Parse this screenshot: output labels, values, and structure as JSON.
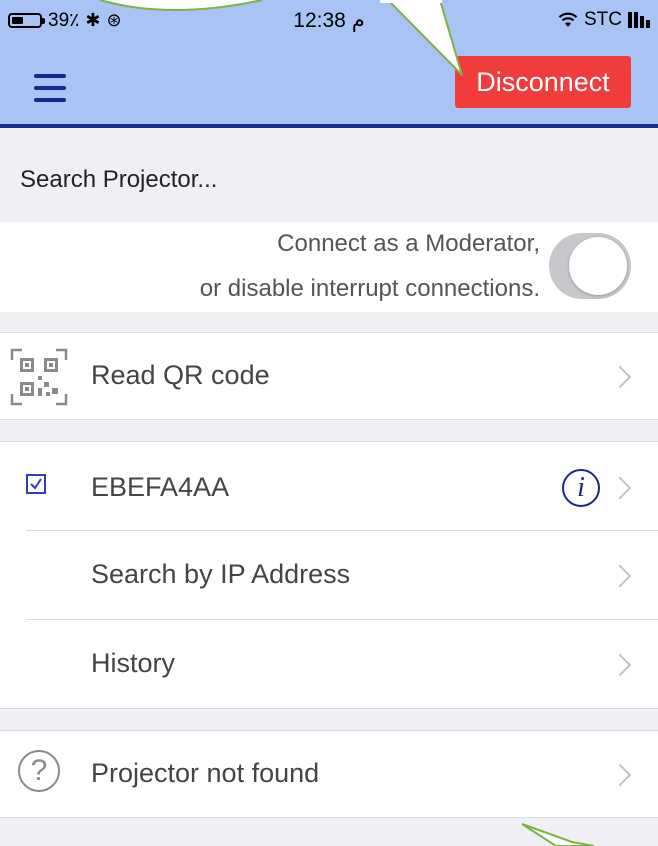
{
  "status_bar": {
    "battery": "39٪",
    "time": "12:38 م",
    "carrier": "STC",
    "battery_level": 0.39
  },
  "header": {
    "disconnect_label": "Disconnect"
  },
  "search": {
    "label": "Search Projector..."
  },
  "moderator": {
    "line1": "Connect as a Moderator,",
    "line2": "or disable interrupt connections.",
    "toggle_on": false
  },
  "qr": {
    "label": "Read QR code"
  },
  "projectors": {
    "items": [
      {
        "label": "EBEFA4AA",
        "checked": true
      },
      {
        "label": "Search by IP Address"
      },
      {
        "label": "History"
      }
    ]
  },
  "help": {
    "label": "Projector not found"
  },
  "colors": {
    "header_bg": "#a9c3f5",
    "accent_blue": "#172d8f",
    "disconnect_red": "#f13c3c",
    "callout_green": "#7cb342"
  },
  "icons": [
    "battery-icon",
    "bluetooth-icon",
    "orientation-lock-icon",
    "wifi-icon",
    "signal-icon",
    "menu-icon",
    "qr-code-icon",
    "checkbox-icon",
    "info-icon",
    "help-icon",
    "chevron-right-icon"
  ]
}
